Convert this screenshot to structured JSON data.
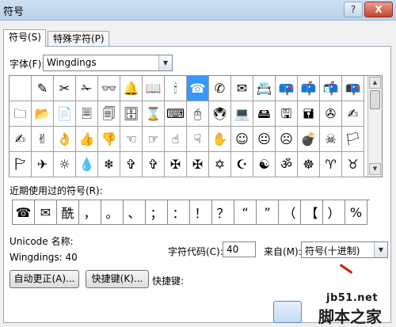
{
  "window": {
    "title": "符号",
    "help_button": "?",
    "close_button": "X"
  },
  "tabs": [
    {
      "label": "符号(S)"
    },
    {
      "label": "特殊字符(P)"
    }
  ],
  "font": {
    "label": "字体(F):",
    "value": "Wingdings"
  },
  "symbols": [
    "",
    "✎",
    "✂",
    "✁",
    "👓",
    "🔔",
    "📖",
    "🕯",
    "☎",
    "✆",
    "✉",
    "📇",
    "📪",
    "📫",
    "📬",
    "📭",
    "🗀",
    "📂",
    "📄",
    "🗏",
    "🗐",
    "🗄",
    "⌛",
    "⌨",
    "🖰",
    "🖲",
    "💻",
    "🖴",
    "🖫",
    "🖬",
    "✇",
    "✍",
    "✍",
    "✌",
    "👌",
    "👍",
    "👎",
    "☜",
    "☞",
    "☝",
    "☟",
    "✋",
    "☺",
    "😐",
    "☹",
    "💣",
    "☠",
    "🏳",
    "🏱",
    "✈",
    "☼",
    "💧",
    "❄",
    "✞",
    "✞",
    "✠",
    "✠",
    "✡",
    "☪",
    "☯",
    "ॐ",
    "☸",
    "♈",
    "♉"
  ],
  "selected_symbol_index": 8,
  "recent": {
    "label": "近期使用过的符号(R):",
    "items": [
      "☎",
      "✉",
      "酰",
      "，",
      "。",
      "、",
      "；",
      "：",
      "！",
      "？",
      "“",
      "”",
      "（",
      "【",
      "）",
      "%"
    ]
  },
  "unicode_name_label": "Unicode 名称:",
  "font_code_text": "Wingdings: 40",
  "char_code": {
    "label": "字符代码(C):",
    "value": "40"
  },
  "from": {
    "label": "来自(M):",
    "value": "符号(十进制)"
  },
  "buttons": {
    "autocorrect": "自动更正(A)...",
    "shortcut_key": "快捷键(K)...",
    "shortcut_label": "快捷键:"
  },
  "watermark": {
    "site": "jb51.net",
    "name": "脚本之家"
  }
}
